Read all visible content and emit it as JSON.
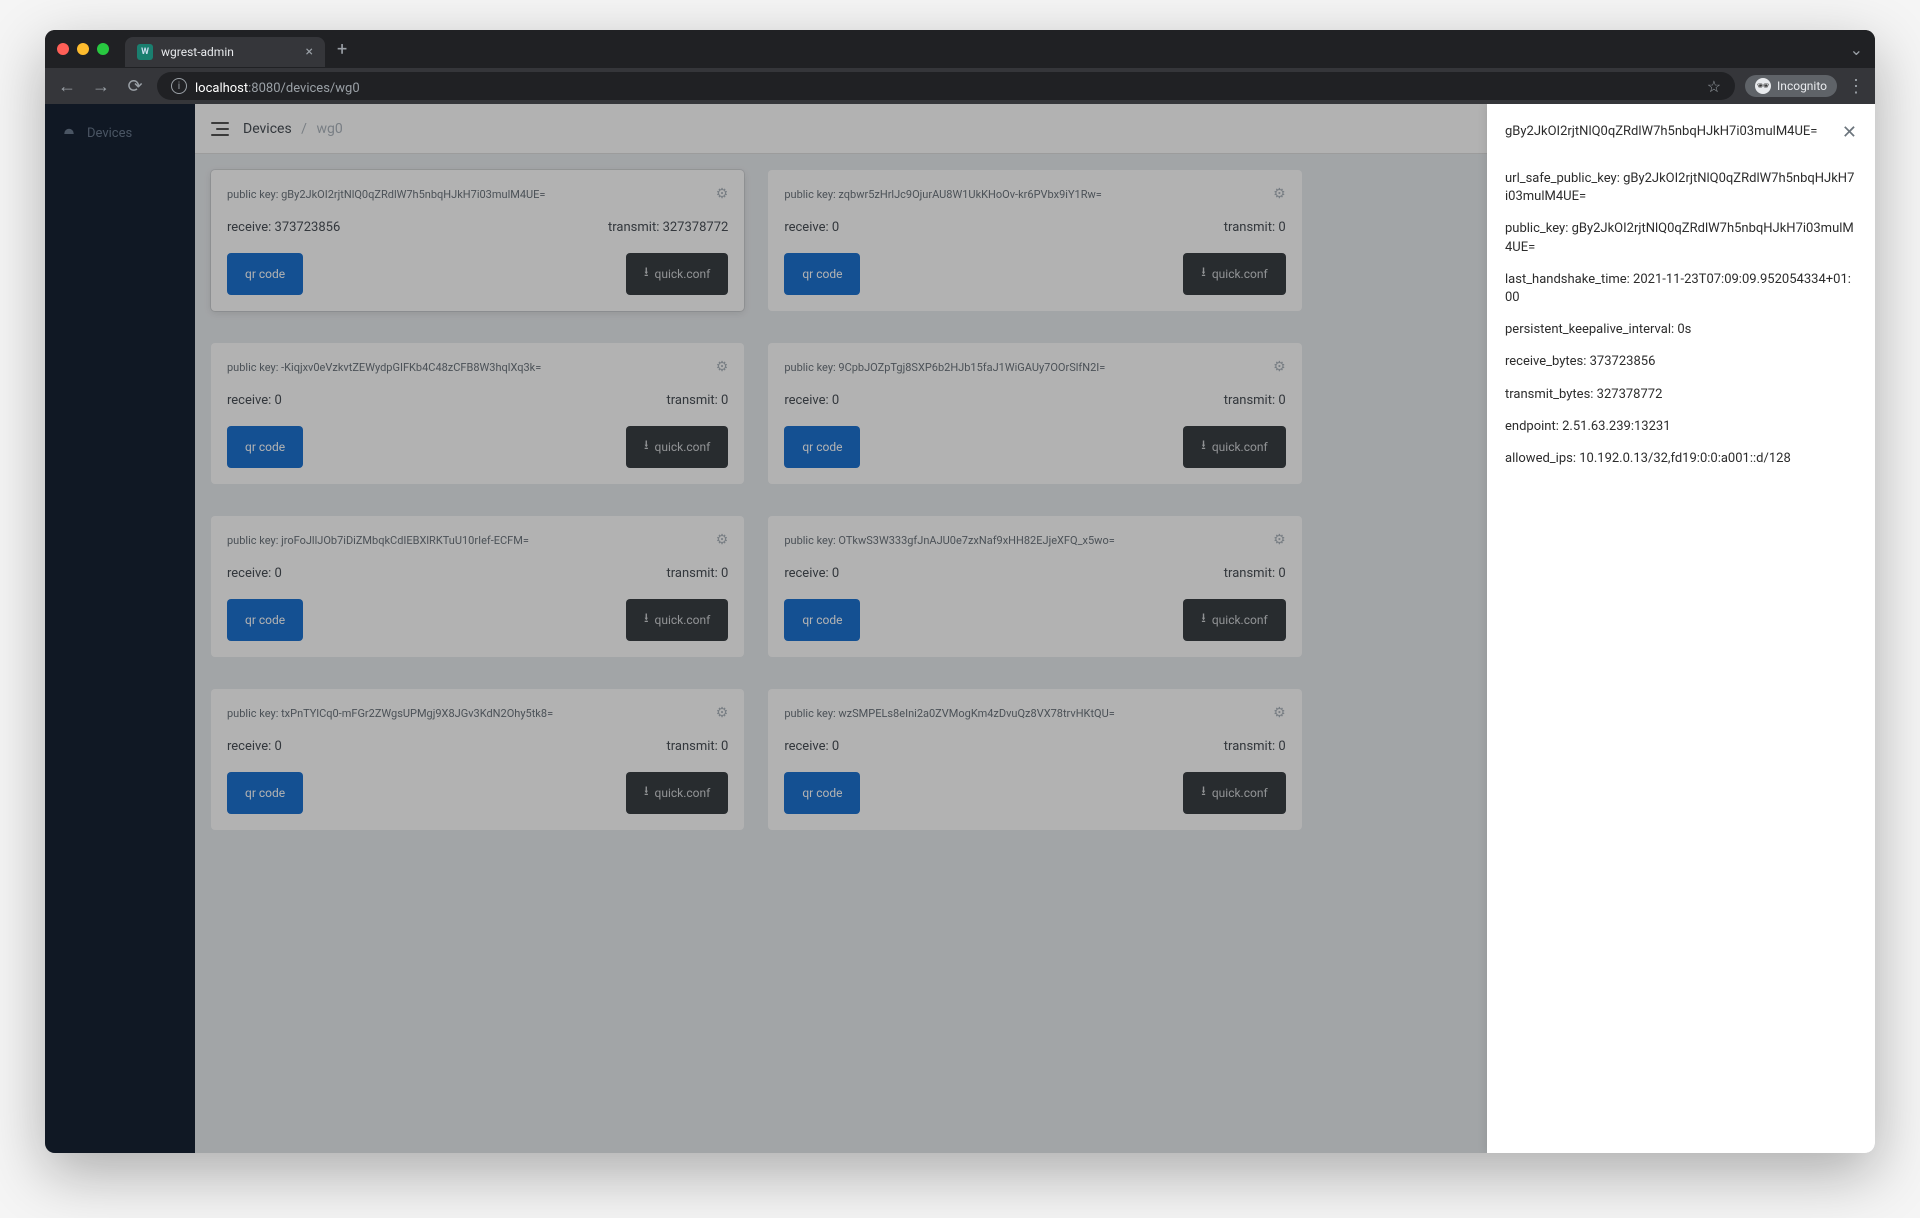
{
  "browser": {
    "tab_title": "wgrest-admin",
    "url_host": "localhost",
    "url_rest": ":8080/devices/wg0",
    "incognito_label": "Incognito"
  },
  "sidebar": {
    "items": [
      {
        "label": "Devices"
      }
    ]
  },
  "breadcrumb": {
    "root": "Devices",
    "current": "wg0"
  },
  "labels": {
    "public_key_prefix": "public key: ",
    "receive_prefix": "receive: ",
    "transmit_prefix": "transmit: ",
    "qr_code": "qr code",
    "quick_conf": "quick.conf"
  },
  "panel": {
    "title": "gBy2JkOI2rjtNlQ0qZRdlW7h5nbqHJkH7i03mulM4UE=",
    "rows": [
      {
        "label": "url_safe_public_key",
        "value": "gBy2JkOI2rjtNlQ0qZRdlW7h5nbqHJkH7i03mulM4UE="
      },
      {
        "label": "public_key",
        "value": "gBy2JkOI2rjtNlQ0qZRdlW7h5nbqHJkH7i03mulM4UE="
      },
      {
        "label": "last_handshake_time",
        "value": "2021-11-23T07:09:09.952054334+01:00"
      },
      {
        "label": "persistent_keepalive_interval",
        "value": "0s"
      },
      {
        "label": "receive_bytes",
        "value": "373723856"
      },
      {
        "label": "transmit_bytes",
        "value": "327378772"
      },
      {
        "label": "endpoint",
        "value": "2.51.63.239:13231"
      },
      {
        "label": "allowed_ips",
        "value": "10.192.0.13/32,fd19:0:0:a001::d/128"
      }
    ]
  },
  "peers": [
    {
      "public_key": "gBy2JkOI2rjtNlQ0qZRdlW7h5nbqHJkH7i03mulM4UE=",
      "receive": "373723856",
      "transmit": "327378772",
      "selected": true
    },
    {
      "public_key": "zqbwr5zHrlJc9OjurAU8W1UkKHoOv-kr6PVbx9iY1Rw=",
      "receive": "0",
      "transmit": "0",
      "selected": false
    },
    {
      "public_key": "",
      "receive": "",
      "transmit": "",
      "selected": false,
      "hidden": true
    },
    {
      "public_key": "-Kiqjxv0eVzkvtZEWydpGIFKb4C48zCFB8W3hqlXq3k=",
      "receive": "0",
      "transmit": "0",
      "selected": false
    },
    {
      "public_key": "9CpbJOZpTgj8SXP6b2HJb15faJ1WiGAUy7OOrSlfN2I=",
      "receive": "0",
      "transmit": "0",
      "selected": false
    },
    {
      "public_key": "",
      "receive": "",
      "transmit": "",
      "selected": false,
      "hidden": true
    },
    {
      "public_key": "jroFoJllJOb7iDiZMbqkCdIEBXlRKTuU10rIef-ECFM=",
      "receive": "0",
      "transmit": "0",
      "selected": false
    },
    {
      "public_key": "OTkwS3W333gfJnAJU0e7zxNaf9xHH82EJjeXFQ_x5wo=",
      "receive": "0",
      "transmit": "0",
      "selected": false
    },
    {
      "public_key": "",
      "receive": "",
      "transmit": "",
      "selected": false,
      "hidden": true
    },
    {
      "public_key": "txPnTYlCq0-mFGr2ZWgsUPMgj9X8JGv3KdN2Ohy5tk8=",
      "receive": "0",
      "transmit": "0",
      "selected": false
    },
    {
      "public_key": "wzSMPELs8eIni2a0ZVMogKm4zDvuQz8VX78trvHKtQU=",
      "receive": "0",
      "transmit": "0",
      "selected": false
    },
    {
      "public_key": "",
      "receive": "",
      "transmit": "",
      "selected": false,
      "hidden": true
    }
  ]
}
